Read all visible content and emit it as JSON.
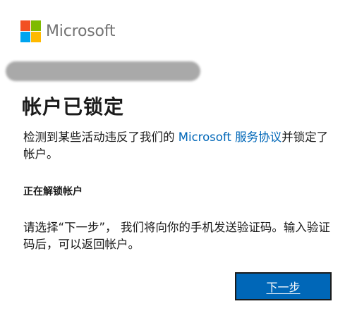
{
  "brand": {
    "name": "Microsoft",
    "logo_colors": [
      "#f25022",
      "#7fba00",
      "#00a4ef",
      "#ffb900"
    ]
  },
  "account": {
    "redacted": true
  },
  "page": {
    "title": "帐户已锁定",
    "description_before": "检测到某些活动违反了我们的 ",
    "agreement_link": "Microsoft 服务协议",
    "description_after": "并锁定了帐户。",
    "subheading": "正在解锁帐户",
    "instructions": "请选择“下一步”， 我们将向你的手机发送验证码。输入验证码后，可以返回帐户。"
  },
  "actions": {
    "next_label": "下一步"
  },
  "colors": {
    "accent": "#0067b8",
    "text": "#1b1b1b",
    "logo_text": "#737373"
  }
}
